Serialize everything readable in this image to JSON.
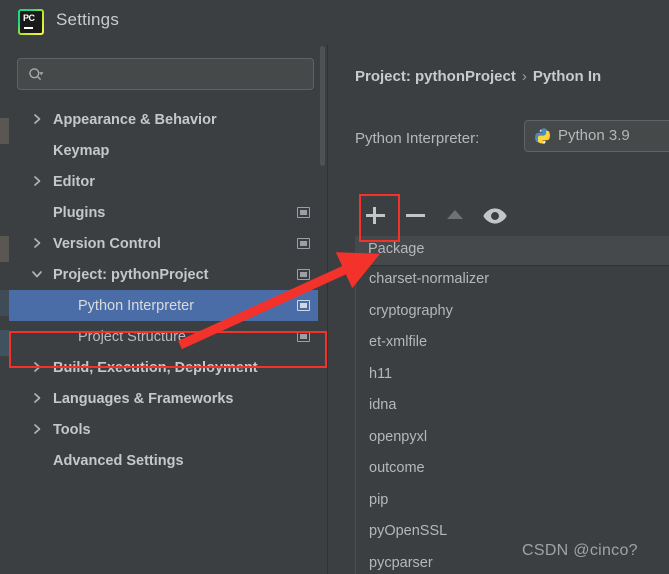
{
  "window": {
    "title": "Settings",
    "app_icon": "pycharm-logo-icon"
  },
  "search": {
    "value": "",
    "placeholder": "",
    "icon": "search-icon"
  },
  "sidebar": {
    "items": [
      {
        "label": "Appearance & Behavior",
        "level": 0,
        "bold": true,
        "arrow": "chevron-right",
        "has_project_icon": false,
        "selected": false
      },
      {
        "label": "Keymap",
        "level": 0,
        "bold": true,
        "arrow": "none",
        "has_project_icon": false,
        "selected": false
      },
      {
        "label": "Editor",
        "level": 0,
        "bold": true,
        "arrow": "chevron-right",
        "has_project_icon": false,
        "selected": false
      },
      {
        "label": "Plugins",
        "level": 0,
        "bold": true,
        "arrow": "none",
        "has_project_icon": true,
        "selected": false
      },
      {
        "label": "Version Control",
        "level": 0,
        "bold": true,
        "arrow": "chevron-right",
        "has_project_icon": true,
        "selected": false
      },
      {
        "label": "Project: pythonProject",
        "level": 0,
        "bold": true,
        "arrow": "chevron-down",
        "has_project_icon": true,
        "selected": false
      },
      {
        "label": "Python Interpreter",
        "level": 1,
        "bold": false,
        "arrow": "none",
        "has_project_icon": true,
        "selected": true
      },
      {
        "label": "Project Structure",
        "level": 1,
        "bold": false,
        "arrow": "none",
        "has_project_icon": true,
        "selected": false
      },
      {
        "label": "Build, Execution, Deployment",
        "level": 0,
        "bold": true,
        "arrow": "chevron-right",
        "has_project_icon": false,
        "selected": false
      },
      {
        "label": "Languages & Frameworks",
        "level": 0,
        "bold": true,
        "arrow": "chevron-right",
        "has_project_icon": false,
        "selected": false
      },
      {
        "label": "Tools",
        "level": 0,
        "bold": true,
        "arrow": "chevron-right",
        "has_project_icon": false,
        "selected": false
      },
      {
        "label": "Advanced Settings",
        "level": 0,
        "bold": true,
        "arrow": "none",
        "has_project_icon": false,
        "selected": false
      }
    ]
  },
  "main": {
    "breadcrumb": {
      "root": "Project: pythonProject",
      "separator": "›",
      "current": "Python In"
    },
    "interpreter": {
      "label": "Python Interpreter:",
      "value": "Python 3.9",
      "icon": "python-logo-icon"
    },
    "toolbar": {
      "add_label": "+",
      "remove_label": "−",
      "upgrade_icon": "triangle-up-icon",
      "eye_icon": "eye-icon"
    },
    "table": {
      "columns": [
        "Package"
      ],
      "rows": [
        "charset-normalizer",
        "cryptography",
        "et-xmlfile",
        "h11",
        "idna",
        "openpyxl",
        "outcome",
        "pip",
        "pyOpenSSL",
        "pycparser"
      ]
    }
  },
  "annotations": {
    "highlight_color": "#f4322c",
    "selection_color": "#4a6da7",
    "watermark": "CSDN @cinco?"
  }
}
